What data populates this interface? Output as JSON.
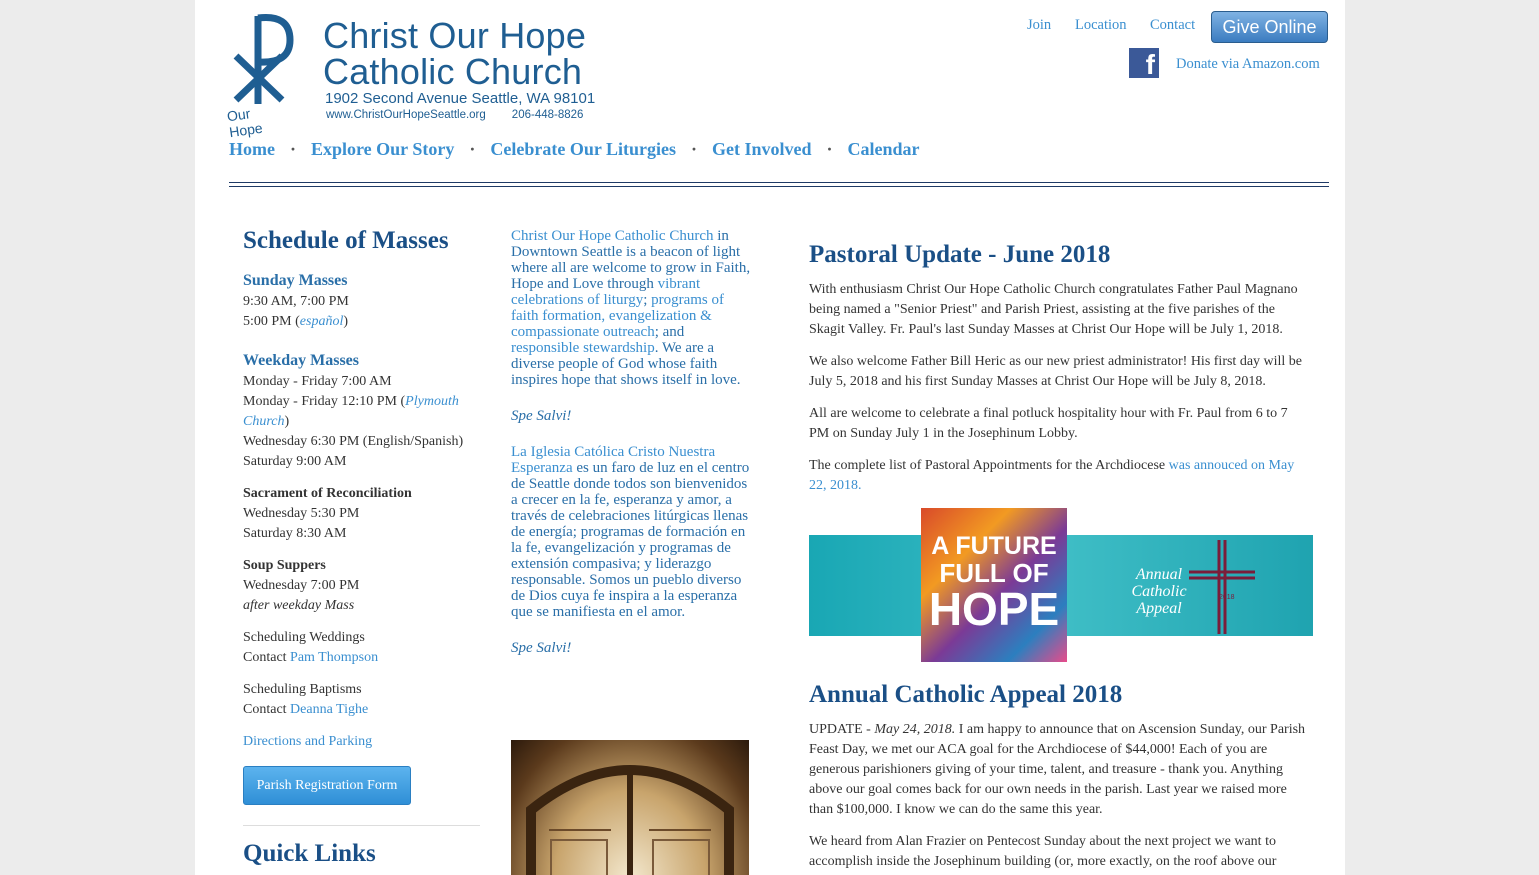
{
  "header": {
    "logo": {
      "name_line1": "Christ Our Hope",
      "name_line2": "Catholic Church",
      "address": "1902 Second Avenue Seattle, WA 98101",
      "website": "www.ChristOurHopeSeattle.org",
      "phone": "206-448-8826",
      "tagline": "Our Hope"
    },
    "top_links": [
      "Join",
      "Location",
      "Contact"
    ],
    "give_button": "Give Online",
    "facebook_icon": "facebook-icon",
    "amazon_link": "Donate via Amazon.com"
  },
  "nav": {
    "items": [
      "Home",
      "Explore Our Story",
      "Celebrate Our Liturgies",
      "Get Involved",
      "Calendar"
    ],
    "separator": "·"
  },
  "sidebar": {
    "title": "Schedule of Masses",
    "sunday": {
      "heading": "Sunday Masses",
      "line1": "9:30 AM, 7:00 PM",
      "line2": "5:00 PM (",
      "espanol": "español",
      "line2_end": ")"
    },
    "weekday": {
      "heading": "Weekday Masses",
      "line1": "Monday - Friday  7:00 AM",
      "line2": "Monday - Friday  12:10 PM (",
      "plymouth": "Plymouth Church",
      "line2_end": ")",
      "line3": "Wednesday  6:30 PM (English/Spanish)",
      "line4": "Saturday  9:00 AM"
    },
    "reconciliation": {
      "heading": "Sacrament of Reconciliation",
      "line1": "Wednesday  5:30 PM",
      "line2": "Saturday  8:30 AM"
    },
    "soup": {
      "heading": "Soup Suppers",
      "line1": "Wednesday 7:00 PM",
      "line2": "after weekday Mass"
    },
    "weddings": {
      "line1": "Scheduling Weddings",
      "contact_prefix": "Contact ",
      "contact_name": "Pam Thompson"
    },
    "baptisms": {
      "line1": "Scheduling Baptisms",
      "contact_prefix": "Contact ",
      "contact_name": "Deanna Tighe"
    },
    "directions": "Directions and Parking",
    "registration_button": "Parish Registration Form",
    "quick_links_title": "Quick Links"
  },
  "middle": {
    "english": {
      "p1": "Christ Our Hope Catholic Church",
      "p2": " in Downtown Seattle is a beacon of light where all are welcome to grow in Faith, Hope and Love through ",
      "p3": "vibrant celebrations of liturgy",
      "p4": "; ",
      "p5": "programs of faith formation, evangelization & compassionate outreach",
      "p6": "; and ",
      "p7": "responsible stewardship",
      "p8": ". We are a diverse people of God whose faith inspires hope that shows itself in love.",
      "motto": "Spe Salvi!"
    },
    "spanish": {
      "p1": "La Iglesia Católica Cristo Nuestra Esperanza",
      "p2": " es un faro de luz en el centro de Seattle donde todos son bienvenidos a crecer en la fe, esperanza y amor, a través de celebraciones litúrgicas llenas de energía; programas de formación en la fe, evangelización y programas de extensión compasiva; y liderazgo responsable. Somos un pueblo diverso de Dios cuya fe inspira a la esperanza que se manifiesta en el amor.",
      "motto": "Spe Salvi!"
    }
  },
  "main": {
    "update": {
      "title": "Pastoral Update - June 2018",
      "p1": "With enthusiasm Christ Our Hope Catholic Church congratulates Father Paul Magnano being named a \"Senior Priest\" and Parish Priest, assisting at the five parishes of the Skagit Valley. Fr. Paul's last Sunday Masses at Christ Our Hope will be July 1, 2018.",
      "p2": "We also welcome Father Bill Heric as our new priest administrator! His first day will be July 5, 2018 and his first Sunday Masses at Christ Our Hope will be July 8, 2018.",
      "p3": "All are welcome to celebrate a final potluck hospitality hour with Fr. Paul from 6 to 7 PM on Sunday July 1 in the Josephinum Lobby.",
      "p4_prefix": "The complete list of Pastoral Appointments for the Archdiocese ",
      "p4_link": "was annouced on May 22, 2018."
    },
    "banner": {
      "line1": "A FUTURE",
      "line2": "FULL OF",
      "line3": "HOPE",
      "aca1": "Annual",
      "aca2": "Catholic",
      "aca3": "Appeal",
      "year": "2018"
    },
    "appeal": {
      "title": "Annual Catholic Appeal 2018",
      "update_prefix": "UPDATE - ",
      "update_date": "May 24, 2018.",
      "p1": " I am happy to announce that on Ascension Sunday, our Parish Feast Day, we met our ACA goal for the Archdiocese of $44,000! Each of you are generous parishioners giving of your time, talent, and treasure - thank you. Anything above our goal comes back for our own needs in the parish. Last year we raised more than $100,000. I know we can do the same this year.",
      "p2": "We heard from Alan Frazier on Pentecost Sunday about the next project we want to accomplish inside the Josephinum building (or, more exactly, on the roof above our Pastoral Center)."
    }
  },
  "colors": {
    "brand": "#1f5e92",
    "link": "#3a8fd0",
    "heading": "#1a4f86"
  }
}
